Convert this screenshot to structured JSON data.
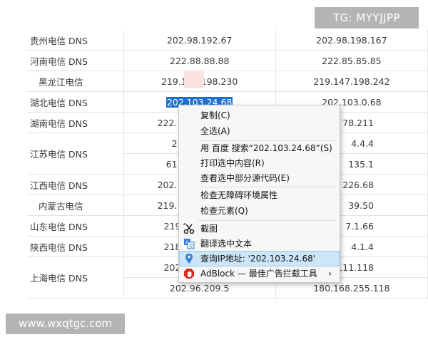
{
  "table": {
    "rows": [
      {
        "name": "贵州电信 DNS",
        "ip1": "202.98.192.67",
        "ip2": "202.98.198.167"
      },
      {
        "name": "河南电信 DNS",
        "ip1": "222.88.88.88",
        "ip2": "222.85.85.85"
      },
      {
        "name": "黑龙江电信",
        "ip1": "219.147.198.230",
        "ip2": "219.147.198.242"
      },
      {
        "name": "湖北电信 DNS",
        "ip1": "202.103.24.68",
        "ip2": "202.103.0.68"
      },
      {
        "name": "湖南电信 DNS",
        "ip1": "222.",
        "ip2": "78.211"
      },
      {
        "name": "江苏电信 DNS",
        "ip1": "2",
        "ip2": "4.4.4"
      },
      {
        "name": "",
        "ip1": "61",
        "ip2": "135.1"
      },
      {
        "name": "江西电信 DNS",
        "ip1": "202.",
        "ip2": "226.68"
      },
      {
        "name": "内蒙古电信",
        "ip1": "219.",
        "ip2": "39.50"
      },
      {
        "name": "山东电信 DNS",
        "ip1": "219",
        "ip2": "7.1.66"
      },
      {
        "name": "陕西电信 DNS",
        "ip1": "218",
        "ip2": "4.1.4"
      },
      {
        "name": "上海电信 DNS",
        "ip1": "202",
        "ip2": "111.118"
      },
      {
        "name": "",
        "ip1": "202.96.209.5",
        "ip2": "180.168.255.118"
      }
    ]
  },
  "context_menu": {
    "copy": "复制(C)",
    "select_all": "全选(A)",
    "search": "用 百度 搜索“202.103.24.68”(S)",
    "print": "打印选中内容(R)",
    "view_source": "查看选中部分源代码(E)",
    "accessibility": "检查无障碍环境属性",
    "inspect": "检查元素(Q)",
    "screenshot": "截图",
    "translate": "翻译选中文本",
    "ip_lookup": "查询IP地址: '202.103.24.68'",
    "adblock": "AdBlock — 最佳广告拦截工具",
    "submenu_arrow": "›"
  },
  "watermarks": {
    "tg": "TG: MYYJJPP",
    "site": "www.wxqtgc.com"
  },
  "colors": {
    "selection": "#1e6fd2",
    "menu_highlight": "#cce6f8",
    "adblock_red": "#e0251b",
    "pin_blue": "#3a7fd5"
  }
}
